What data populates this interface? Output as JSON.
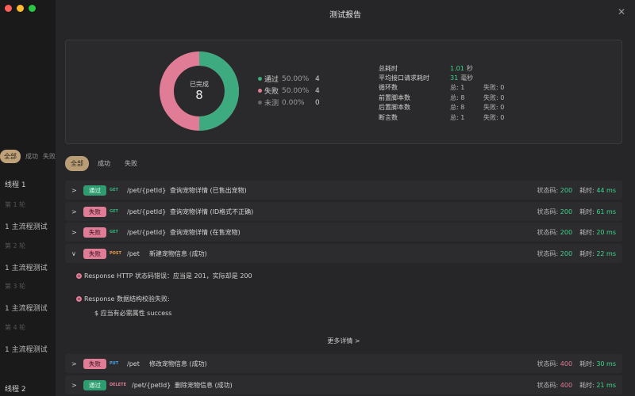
{
  "bg": {
    "filters": [
      "全部",
      "成功",
      "失败"
    ],
    "thread1": "线程 1",
    "rounds": [
      "第 1 轮",
      "第 2 轮",
      "第 3 轮",
      "第 4 轮"
    ],
    "process": "1   主流程测试",
    "thread2": "线程 2"
  },
  "modal": {
    "title": "测试报告",
    "close_icon": "close-icon"
  },
  "summary": {
    "donut_label": "已完成",
    "donut_count": "8",
    "legend": [
      {
        "name": "通过",
        "pct": "50.00%",
        "count": "4",
        "color": "#3daa80"
      },
      {
        "name": "失败",
        "pct": "50.00%",
        "count": "4",
        "color": "#e07c95"
      },
      {
        "name": "未测",
        "pct": "0.00%",
        "count": "0",
        "color": "#666666"
      }
    ],
    "stats": {
      "total_time_label": "总耗时",
      "total_time_val": "1.01",
      "total_time_unit": "秒",
      "avg_label": "平均接口请求耗时",
      "avg_val": "31",
      "avg_unit": "毫秒",
      "loops_label": "循环数",
      "loops_total": "总: 1",
      "loops_fail": "失败: 0",
      "pre_label": "前置脚本数",
      "pre_total": "总: 8",
      "pre_fail": "失败: 0",
      "post_label": "后置脚本数",
      "post_total": "总: 8",
      "post_fail": "失败: 0",
      "assert_label": "断言数",
      "assert_total": "总: 1",
      "assert_fail": "失败: 0"
    }
  },
  "filters": [
    "全部",
    "成功",
    "失败"
  ],
  "rows": [
    {
      "status": "通过",
      "method": "GET",
      "path": "/pet/{petId}",
      "desc": "查询宠物详情 (已售出宠物)",
      "code_label": "状态码:",
      "code": "200",
      "time_label": "耗时:",
      "time": "44 ms"
    },
    {
      "status": "失败",
      "method": "GET",
      "path": "/pet/{petId}",
      "desc": "查询宠物详情 (ID格式不正确)",
      "code_label": "状态码:",
      "code": "200",
      "time_label": "耗时:",
      "time": "61 ms"
    },
    {
      "status": "失败",
      "method": "GET",
      "path": "/pet/{petId}",
      "desc": "查询宠物详情 (在售宠物)",
      "code_label": "状态码:",
      "code": "200",
      "time_label": "耗时:",
      "time": "20 ms"
    },
    {
      "status": "失败",
      "method": "POST",
      "path": "/pet",
      "desc": "新建宠物信息 (成功)",
      "code_label": "状态码:",
      "code": "200",
      "time_label": "耗时:",
      "time": "22 ms"
    },
    {
      "status": "失败",
      "method": "PUT",
      "path": "/pet",
      "desc": "修改宠物信息 (成功)",
      "code_label": "状态码:",
      "code": "400",
      "time_label": "耗时:",
      "time": "30 ms"
    },
    {
      "status": "通过",
      "method": "DELETE",
      "path": "/pet/{petId}",
      "desc": "删除宠物信息 (成功)",
      "code_label": "状态码:",
      "code": "400",
      "time_label": "耗时:",
      "time": "21 ms"
    }
  ],
  "detail": {
    "error1": "Response HTTP 状态码错误：应当是 201，实际却是 200",
    "error2": "Response 数据结构校验失败:",
    "error2_sub": "$ 应当有必需属性 success",
    "more": "更多详情 >"
  }
}
